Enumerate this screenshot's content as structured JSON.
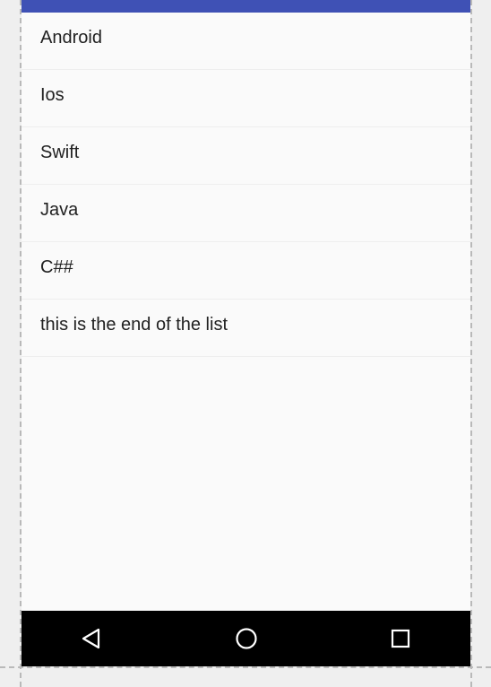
{
  "app_bar": {
    "color": "#3f51b5"
  },
  "list": {
    "items": [
      {
        "label": "Android"
      },
      {
        "label": "Ios"
      },
      {
        "label": "Swift"
      },
      {
        "label": "Java"
      },
      {
        "label": "C##"
      },
      {
        "label": "this is the end of the list"
      }
    ]
  },
  "nav_bar": {
    "buttons": [
      {
        "icon": "back-triangle-icon"
      },
      {
        "icon": "home-circle-icon"
      },
      {
        "icon": "recents-square-icon"
      }
    ]
  }
}
